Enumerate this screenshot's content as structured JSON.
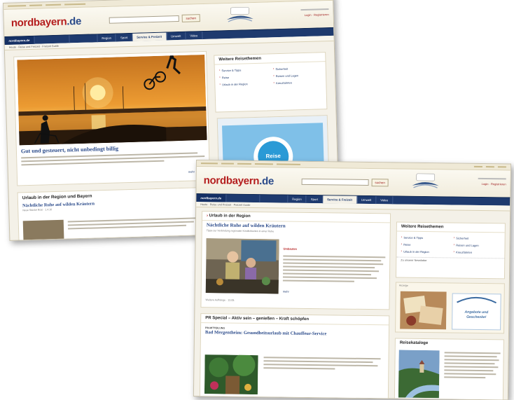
{
  "brand": {
    "logo_main": "nordbayern",
    "logo_tld": ".de",
    "accent": "#b41d1d",
    "nav_blue": "#1e3a6e"
  },
  "page1": {
    "search_button": "suchen",
    "masthead_links": "Login · Registrieren",
    "nav": [
      "nordbayern.de",
      "",
      "Region",
      "Sport",
      "Service & Freizeit",
      "Umwelt",
      "Video"
    ],
    "breadcrumb": "Heute · Reise und Freizeit · Freizeit Guide",
    "feature_headline": "Gut und gesteuert, nicht unbedingt billig",
    "more_label": "mehr",
    "side_title": "Weitere Reisethemen",
    "side_links": [
      "Service & Tipps",
      "Sicherheit",
      "Reise",
      "Reisen und Lagen",
      "Urlaub in der Region",
      "Kreuzfahrten"
    ],
    "region_title": "Urlaub in der Region und Bayern",
    "region_headline": "Nächtliche Ruhe auf wilden Kräutern",
    "region_meta": "Neue Stücke Rosi · 1.4.16",
    "blue_badge": "Reise"
  },
  "page2": {
    "search_button": "suchen",
    "masthead_links": "Login · Registrieren",
    "nav": [
      "nordbayern.de",
      "",
      "Region",
      "Sport",
      "Service & Freizeit",
      "Umwelt",
      "Video"
    ],
    "breadcrumb": "Heute · Reise und Freizeit · Freizeit Guide",
    "region_title": "Urlaub in der Region",
    "region_headline": "Nächtliche Ruhe auf wilden Kräutern",
    "region_intro": "Tipps zur Verbindung regionaler Köstlichkeiten in einer Ruhe",
    "region_red": "Umbauten",
    "more_label": "mehr",
    "region_foot": "Weitere Aufhänge · 13.05.",
    "side_title": "Weitere Reisethemen",
    "side_links": [
      "Service & Tipps",
      "Sicherheit",
      "Reise",
      "Reisen und Lagen",
      "Urlaub in der Region",
      "Kreuzfahrten"
    ],
    "side_note": "Zu unserer Newsletter",
    "ad_label": "Anzeige",
    "ad_text": "Angebote und Geschenke!",
    "pr_title": "PR Special – Aktiv sein – genießen – Kraft schöpfen",
    "pr_label": "PR-MITTEILUNG",
    "pr_headline": "Bad Mergentheim: Gesundheitsurlaub mit Chauffeur-Service",
    "catalog_title": "Reisekataloge"
  }
}
